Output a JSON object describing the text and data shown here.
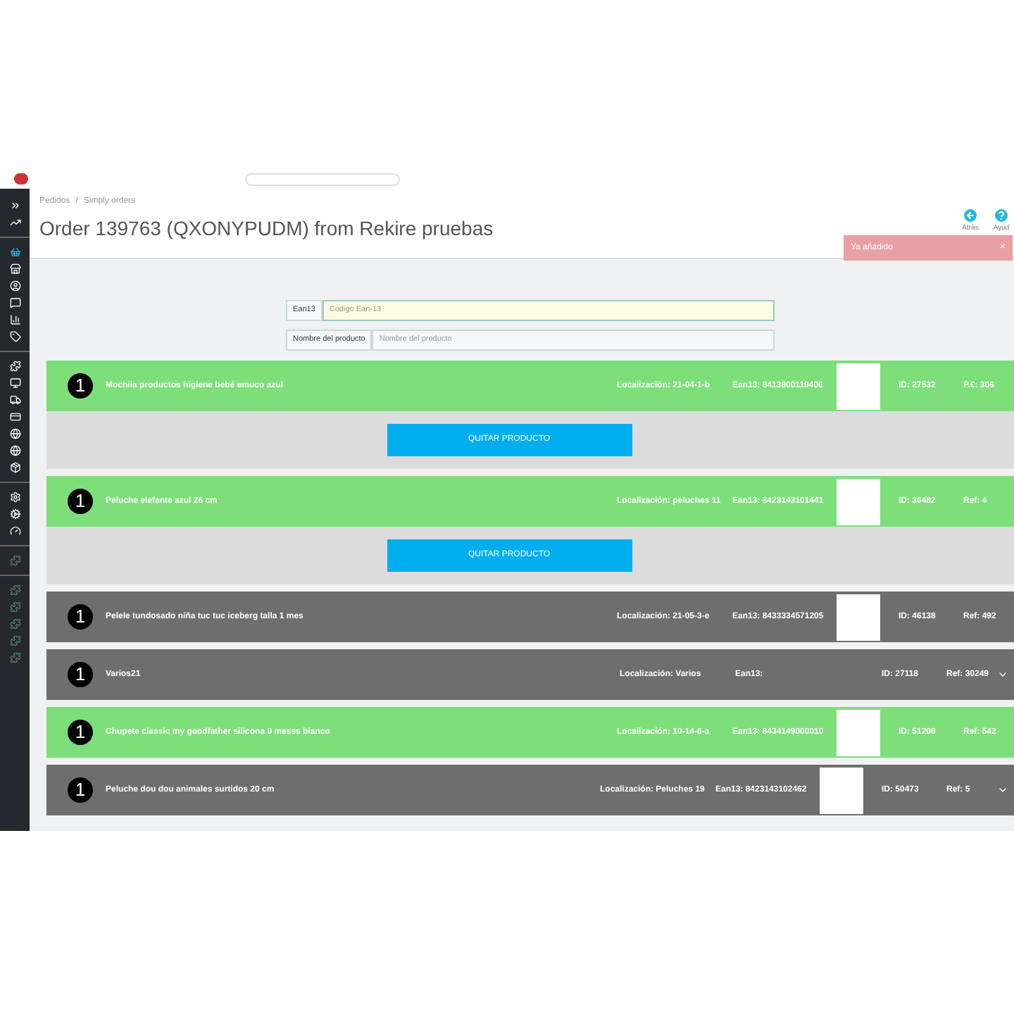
{
  "breadcrumb": [
    "Pedidos",
    "/",
    "Simply orders"
  ],
  "title": "Order 139763 (QXONYPUDM) from Rekire pruebas",
  "toolbar": [
    {
      "kind": "back",
      "label": "Atrás"
    },
    {
      "kind": "help",
      "label": "Ayud"
    }
  ],
  "toast": {
    "message": "Ya añadido",
    "close": "×"
  },
  "search": [
    {
      "label": "Ean13",
      "placeholder": "Codigo Ean-13",
      "focused": true
    },
    {
      "label": "Nombre del producto",
      "placeholder": "Nombre del producto",
      "focused": false
    }
  ],
  "items": [
    {
      "qty": "1",
      "name": "Mochila productos higiene bebé emuco azul",
      "location": "Localización: 21-04-1-b",
      "ean": "Ean13: 8413800119406",
      "photo": true,
      "id": "ID: 27532",
      "ref": "P.€: 306",
      "picked": true,
      "chevron": false,
      "expanded": true,
      "action": "QUITAR PRODUCTO"
    },
    {
      "qty": "1",
      "name": "Peluche elefante azul 26 cm",
      "location": "Localización: peluches 11",
      "ean": "Ean13: 8423143101441",
      "photo": true,
      "id": "ID: 36482",
      "ref": "Ref: 4",
      "picked": true,
      "chevron": false,
      "expanded": true,
      "action": "QUITAR PRODUCTO"
    },
    {
      "qty": "1",
      "name": "Pelele tundosado niña tuc tuc iceberg talla 1 mes",
      "location": "Localización: 21-05-3-e",
      "ean": "Ean13: 8433334571205",
      "photo": true,
      "id": "ID: 46138",
      "ref": "Ref: 492",
      "picked": false,
      "chevron": false,
      "expanded": false
    },
    {
      "qty": "1",
      "name": "Varios21",
      "location": "Localización: Varios",
      "ean": "Ean13:",
      "photo": false,
      "id": "ID: 27118",
      "ref": "Ref: 30249",
      "picked": false,
      "chevron": true,
      "expanded": false
    },
    {
      "qty": "1",
      "name": "Chupete classic my goodfather silicona 0 meses blanco",
      "location": "Localización: 10-14-6-a",
      "ean": "Ean13: 8434149000010",
      "photo": true,
      "id": "ID: 51200",
      "ref": "Ref: 542",
      "picked": true,
      "chevron": false,
      "expanded": false
    },
    {
      "qty": "1",
      "name": "Peluche dou dou animales surtidos 20 cm",
      "location": "Localización: Peluches 19",
      "ean": "Ean13: 8423143102462",
      "photo": true,
      "id": "ID: 50473",
      "ref": "Ref: 5",
      "picked": false,
      "chevron": true,
      "expanded": false
    }
  ]
}
